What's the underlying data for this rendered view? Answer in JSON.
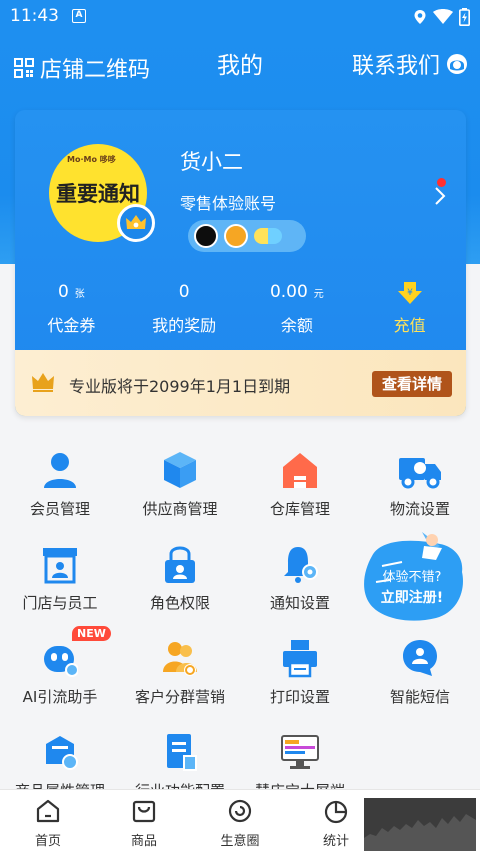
{
  "status_bar": {
    "time": "11:43",
    "notification_icon": "A"
  },
  "nav": {
    "qr_label": "店铺二维码",
    "title": "我的",
    "contact_label": "联系我们"
  },
  "profile": {
    "avatar_text": "重要通知",
    "avatar_brand": "Mo·Mo 哆哆",
    "name": "货小二",
    "account_type": "零售体验账号"
  },
  "stats": [
    {
      "value": "0",
      "unit": "张",
      "label": "代金券"
    },
    {
      "value": "0",
      "unit": "",
      "label": "我的奖励"
    },
    {
      "value": "0.00",
      "unit": "元",
      "label": "余额"
    },
    {
      "value": "",
      "unit": "",
      "label": "充值"
    }
  ],
  "vip": {
    "text": "专业版将于2099年1月1日到期",
    "button": "查看详情"
  },
  "menu": [
    {
      "label": "会员管理",
      "icon": "member-icon"
    },
    {
      "label": "供应商管理",
      "icon": "supplier-box-icon"
    },
    {
      "label": "仓库管理",
      "icon": "warehouse-icon"
    },
    {
      "label": "物流设置",
      "icon": "logistics-truck-icon"
    },
    {
      "label": "门店与员工",
      "icon": "store-icon"
    },
    {
      "label": "角色权限",
      "icon": "role-lock-icon"
    },
    {
      "label": "通知设置",
      "icon": "bell-gear-icon"
    },
    {
      "label": "AI引流助手",
      "icon": "ai-robot-icon",
      "badge": "NEW"
    },
    {
      "label": "客户分群营销",
      "icon": "customer-group-icon"
    },
    {
      "label": "打印设置",
      "icon": "printer-icon"
    },
    {
      "label": "智能短信",
      "icon": "sms-icon"
    },
    {
      "label": "商品属性管理",
      "icon": "product-attr-icon"
    },
    {
      "label": "行业功能配置",
      "icon": "industry-config-icon"
    },
    {
      "label": "慧店宝大屏端",
      "icon": "big-screen-icon"
    }
  ],
  "promo": {
    "line1": "体验不错?",
    "line2": "立即注册!"
  },
  "tabs": [
    {
      "label": "首页",
      "icon": "home-icon"
    },
    {
      "label": "商品",
      "icon": "bag-icon"
    },
    {
      "label": "生意圈",
      "icon": "circle-icon"
    },
    {
      "label": "统计",
      "icon": "pie-icon"
    }
  ],
  "colors": {
    "primary": "#1e8ff0",
    "accent_orange": "#ff7a3c",
    "vip_button": "#b0541a",
    "recharge": "#ffe25a"
  }
}
